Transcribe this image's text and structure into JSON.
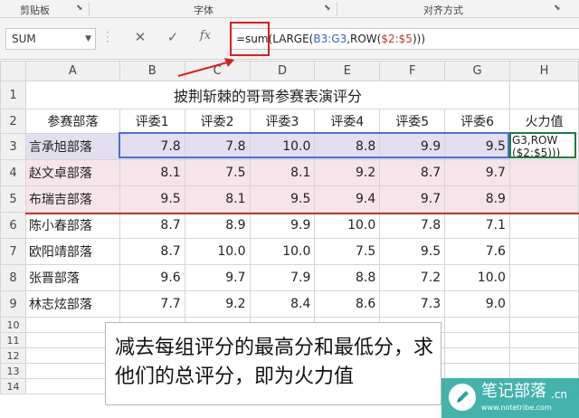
{
  "ribbon": {
    "groups": [
      "剪贴板",
      "字体",
      "对齐方式"
    ]
  },
  "formula_bar": {
    "name_box": "SUM",
    "cancel_icon": "close-icon",
    "enter_icon": "check-icon",
    "fx_label": "fx",
    "formula_parts": [
      "=sum(LARGE(",
      "B3:G3",
      ",ROW(",
      "$2:$5",
      ")))"
    ]
  },
  "columns": [
    "A",
    "B",
    "C",
    "D",
    "E",
    "F",
    "G",
    "H"
  ],
  "rows": [
    "1",
    "2",
    "3",
    "4",
    "5",
    "6",
    "7",
    "8",
    "9",
    "10",
    "11",
    "12",
    "13",
    "14"
  ],
  "sheet": {
    "title": "披荆斩棘的哥哥参赛表演评分",
    "headers": [
      "参赛部落",
      "评委1",
      "评委2",
      "评委3",
      "评委4",
      "评委5",
      "评委6",
      "火力值"
    ],
    "h3_formula": "G3,ROW($2:$5)))",
    "data": [
      [
        "言承旭部落",
        "7.8",
        "7.8",
        "10.0",
        "8.8",
        "9.9",
        "9.5"
      ],
      [
        "赵文卓部落",
        "8.1",
        "7.5",
        "8.1",
        "9.2",
        "8.7",
        "9.7"
      ],
      [
        "布瑞吉部落",
        "9.5",
        "8.1",
        "9.5",
        "9.4",
        "9.7",
        "8.9"
      ],
      [
        "陈小春部落",
        "8.7",
        "8.9",
        "9.9",
        "10.0",
        "7.8",
        "7.1"
      ],
      [
        "欧阳靖部落",
        "8.7",
        "10.0",
        "10.0",
        "7.5",
        "9.5",
        "7.6"
      ],
      [
        "张晋部落",
        "9.6",
        "9.7",
        "7.9",
        "8.8",
        "7.2",
        "10.0"
      ],
      [
        "林志炫部落",
        "7.7",
        "9.2",
        "8.4",
        "8.6",
        "7.3",
        "9.0"
      ]
    ]
  },
  "caption": {
    "line1": "减去每组评分的最高分和最低分，求",
    "line2": "他们的总评分，即为火力值"
  },
  "watermark": {
    "name": "笔记部落",
    "cn": ".cn",
    "url": "www.notetribe.com"
  },
  "colors": {
    "highlight_rows": "#f6e4ea",
    "selected_row": "#e4dff0",
    "selection_border": "#4a6fd6",
    "annotation_red": "#d81e1e",
    "watermark_bg": "#2aa8a0"
  }
}
